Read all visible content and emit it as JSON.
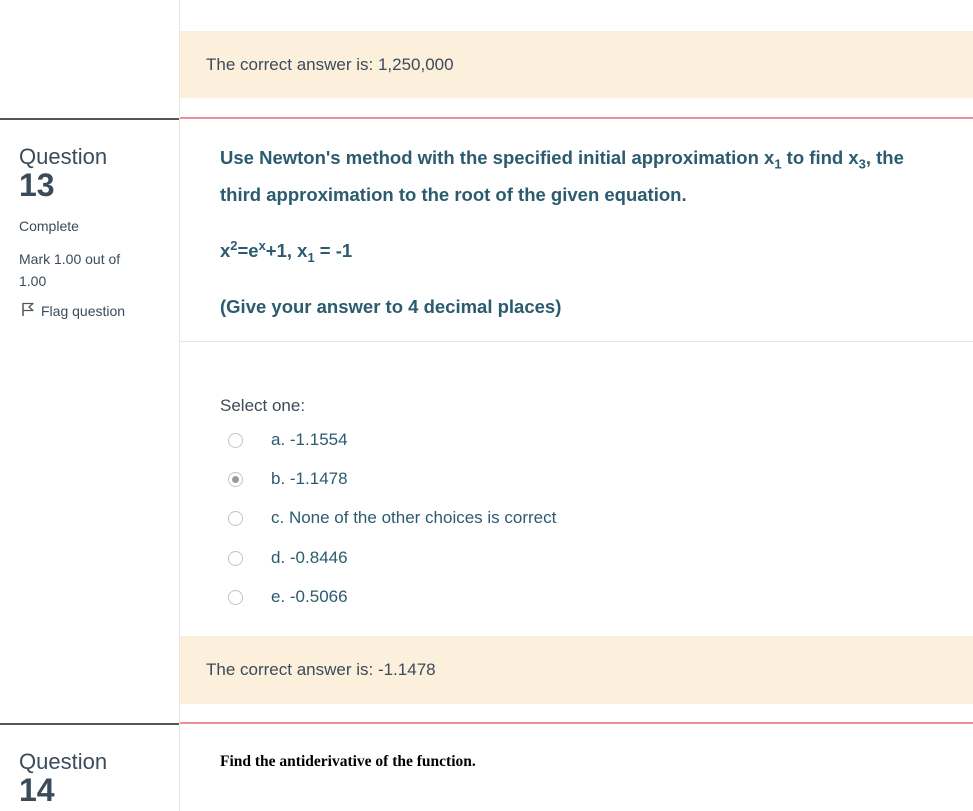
{
  "prev_feedback": {
    "text": "The correct answer is: 1,250,000"
  },
  "q13": {
    "label": "Question",
    "number": "13",
    "status": "Complete",
    "mark_line1": "Mark 1.00 out of",
    "mark_line2": "1.00",
    "flag_label": "Flag question",
    "text": {
      "line1_a": "Use Newton's method with the specified initial approximation x",
      "line1_sub1": "1",
      "line1_b": " to find x",
      "line1_sub2": "3",
      "line1_c": ", the",
      "line2": "third approximation to the root of the given equation.",
      "eq_x": "x",
      "eq_sup2": "2",
      "eq_mid": "=e",
      "eq_supx": "x",
      "eq_tail": "+1, x",
      "eq_sub1": "1",
      "eq_end": " = -1",
      "instruction": "(Give your answer to 4 decimal places)"
    },
    "select_one": "Select one:",
    "options": [
      {
        "label": "a. -1.1554",
        "checked": false
      },
      {
        "label": "b. -1.1478",
        "checked": true
      },
      {
        "label": "c. None of the other choices is correct",
        "checked": false
      },
      {
        "label": "d. -0.8446",
        "checked": false
      },
      {
        "label": "e. -0.5066",
        "checked": false
      }
    ],
    "feedback": "The correct answer is: -1.1478"
  },
  "q14": {
    "label": "Question",
    "number": "14",
    "text": "Find the antiderivative of the function."
  },
  "colors": {
    "feedback_bg": "#fcefdc",
    "question_text": "#2b5b6f",
    "divider_accent": "#f08b9a"
  }
}
